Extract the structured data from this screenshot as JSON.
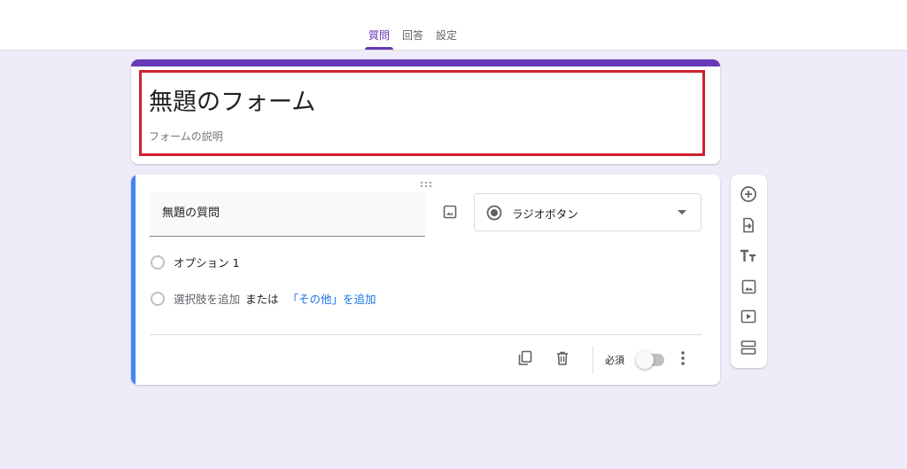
{
  "tabs": [
    {
      "label": "質問",
      "active": true
    },
    {
      "label": "回答",
      "active": false
    },
    {
      "label": "設定",
      "active": false
    }
  ],
  "form": {
    "title": "無題のフォーム",
    "description": "フォームの説明"
  },
  "question": {
    "title": "無題の質問",
    "type_label": "ラジオボタン",
    "option_1": "オプション 1",
    "add_option": "選択肢を追加",
    "or_text": "または",
    "add_other": "「その他」を追加",
    "required_label": "必須",
    "required": false
  },
  "sidebar": {
    "icons": [
      "add-question-icon",
      "import-questions-icon",
      "add-title-icon",
      "add-image-icon",
      "add-video-icon",
      "add-section-icon"
    ]
  },
  "colors": {
    "accent": "#673ab7",
    "active_question": "#4285f4",
    "highlight_border": "#d0202f",
    "background": "#f0ebf8",
    "link": "#1a73e8"
  }
}
